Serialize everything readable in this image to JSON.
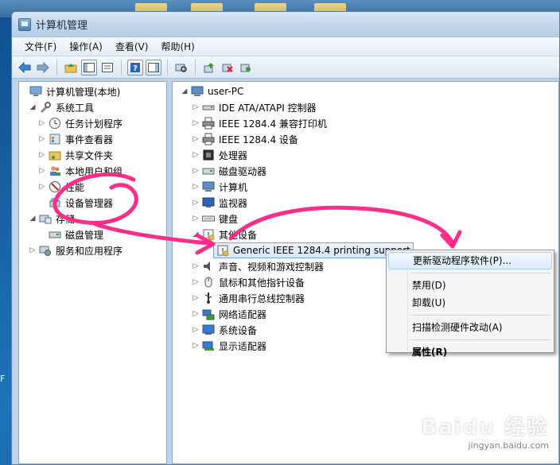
{
  "window": {
    "title": "计算机管理"
  },
  "menu": [
    "文件(F)",
    "操作(A)",
    "查看(V)",
    "帮助(H)"
  ],
  "left_tree": [
    {
      "label": "计算机管理(本地)",
      "icon": "computer-management-icon",
      "level": 0,
      "arrow": ""
    },
    {
      "label": "系统工具",
      "icon": "tools-icon",
      "level": 1,
      "arrow": "expanded"
    },
    {
      "label": "任务计划程序",
      "icon": "clock-icon",
      "level": 2,
      "arrow": "collapsed"
    },
    {
      "label": "事件查看器",
      "icon": "event-viewer-icon",
      "level": 2,
      "arrow": "collapsed"
    },
    {
      "label": "共享文件夹",
      "icon": "shared-folder-icon",
      "level": 2,
      "arrow": "collapsed"
    },
    {
      "label": "本地用户和组",
      "icon": "users-icon",
      "level": 2,
      "arrow": "collapsed"
    },
    {
      "label": "性能",
      "icon": "performance-icon",
      "level": 2,
      "arrow": "collapsed"
    },
    {
      "label": "设备管理器",
      "icon": "device-manager-icon",
      "level": 2,
      "arrow": ""
    },
    {
      "label": "存储",
      "icon": "storage-icon",
      "level": 1,
      "arrow": "expanded"
    },
    {
      "label": "磁盘管理",
      "icon": "disk-icon",
      "level": 2,
      "arrow": ""
    },
    {
      "label": "服务和应用程序",
      "icon": "services-icon",
      "level": 1,
      "arrow": "collapsed"
    }
  ],
  "right_tree": [
    {
      "label": "user-PC",
      "icon": "computer-icon",
      "level": 0,
      "arrow": "expanded"
    },
    {
      "label": "IDE ATA/ATAPI 控制器",
      "icon": "ide-controller-icon",
      "level": 1,
      "arrow": "collapsed"
    },
    {
      "label": "IEEE 1284.4 兼容打印机",
      "icon": "printer-icon",
      "level": 1,
      "arrow": "collapsed"
    },
    {
      "label": "IEEE 1284.4 设备",
      "icon": "printer-icon",
      "level": 1,
      "arrow": "collapsed"
    },
    {
      "label": "处理器",
      "icon": "processor-icon",
      "level": 1,
      "arrow": "collapsed"
    },
    {
      "label": "磁盘驱动器",
      "icon": "disk-drive-icon",
      "level": 1,
      "arrow": "collapsed"
    },
    {
      "label": "计算机",
      "icon": "computer-icon",
      "level": 1,
      "arrow": "collapsed"
    },
    {
      "label": "监视器",
      "icon": "monitor-icon",
      "level": 1,
      "arrow": "collapsed"
    },
    {
      "label": "键盘",
      "icon": "keyboard-icon",
      "level": 1,
      "arrow": "collapsed"
    },
    {
      "label": "其他设备",
      "icon": "unknown-device-icon",
      "level": 1,
      "arrow": "expanded"
    },
    {
      "label": "Generic IEEE 1284.4 printing support",
      "icon": "unknown-device-icon",
      "level": 2,
      "arrow": ""
    },
    {
      "label": "声音、视频和游戏控制器",
      "icon": "speaker-icon",
      "level": 1,
      "arrow": "collapsed"
    },
    {
      "label": "鼠标和其他指针设备",
      "icon": "mouse-icon",
      "level": 1,
      "arrow": "collapsed"
    },
    {
      "label": "通用串行总线控制器",
      "icon": "usb-icon",
      "level": 1,
      "arrow": "collapsed"
    },
    {
      "label": "网络适配器",
      "icon": "network-adapter-icon",
      "level": 1,
      "arrow": "collapsed"
    },
    {
      "label": "系统设备",
      "icon": "system-device-icon",
      "level": 1,
      "arrow": "collapsed"
    },
    {
      "label": "显示适配器",
      "icon": "display-adapter-icon",
      "level": 1,
      "arrow": "collapsed"
    }
  ],
  "context_menu": {
    "update_driver": "更新驱动程序软件(P)...",
    "disable": "禁用(D)",
    "uninstall": "卸载(U)",
    "scan": "扫描检测硬件改动(A)",
    "properties": "属性(R)"
  },
  "watermark": {
    "logo": "Baidu 经验",
    "url": "jingyan.baidu.com"
  },
  "edge_text": "F",
  "colors": {
    "annotation": "#ff2d8a",
    "selection_border": "#7da2ce"
  }
}
